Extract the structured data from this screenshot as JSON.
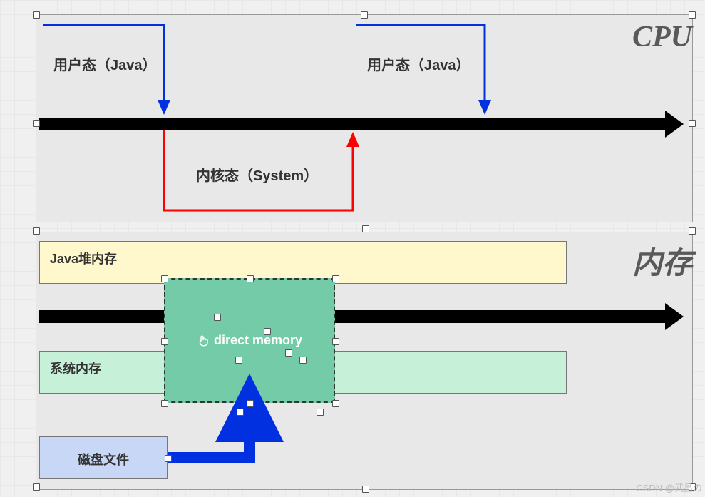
{
  "cpu": {
    "title": "CPU",
    "user_mode_1": "用户态（Java）",
    "user_mode_2": "用户态（Java）",
    "kernel_mode": "内核态（System）"
  },
  "memory": {
    "title": "内存",
    "java_heap": "Java堆内存",
    "system_memory": "系统内存",
    "direct_memory": "direct memory",
    "disk_file": "磁盘文件"
  },
  "watermark": "CSDN @武昌の"
}
